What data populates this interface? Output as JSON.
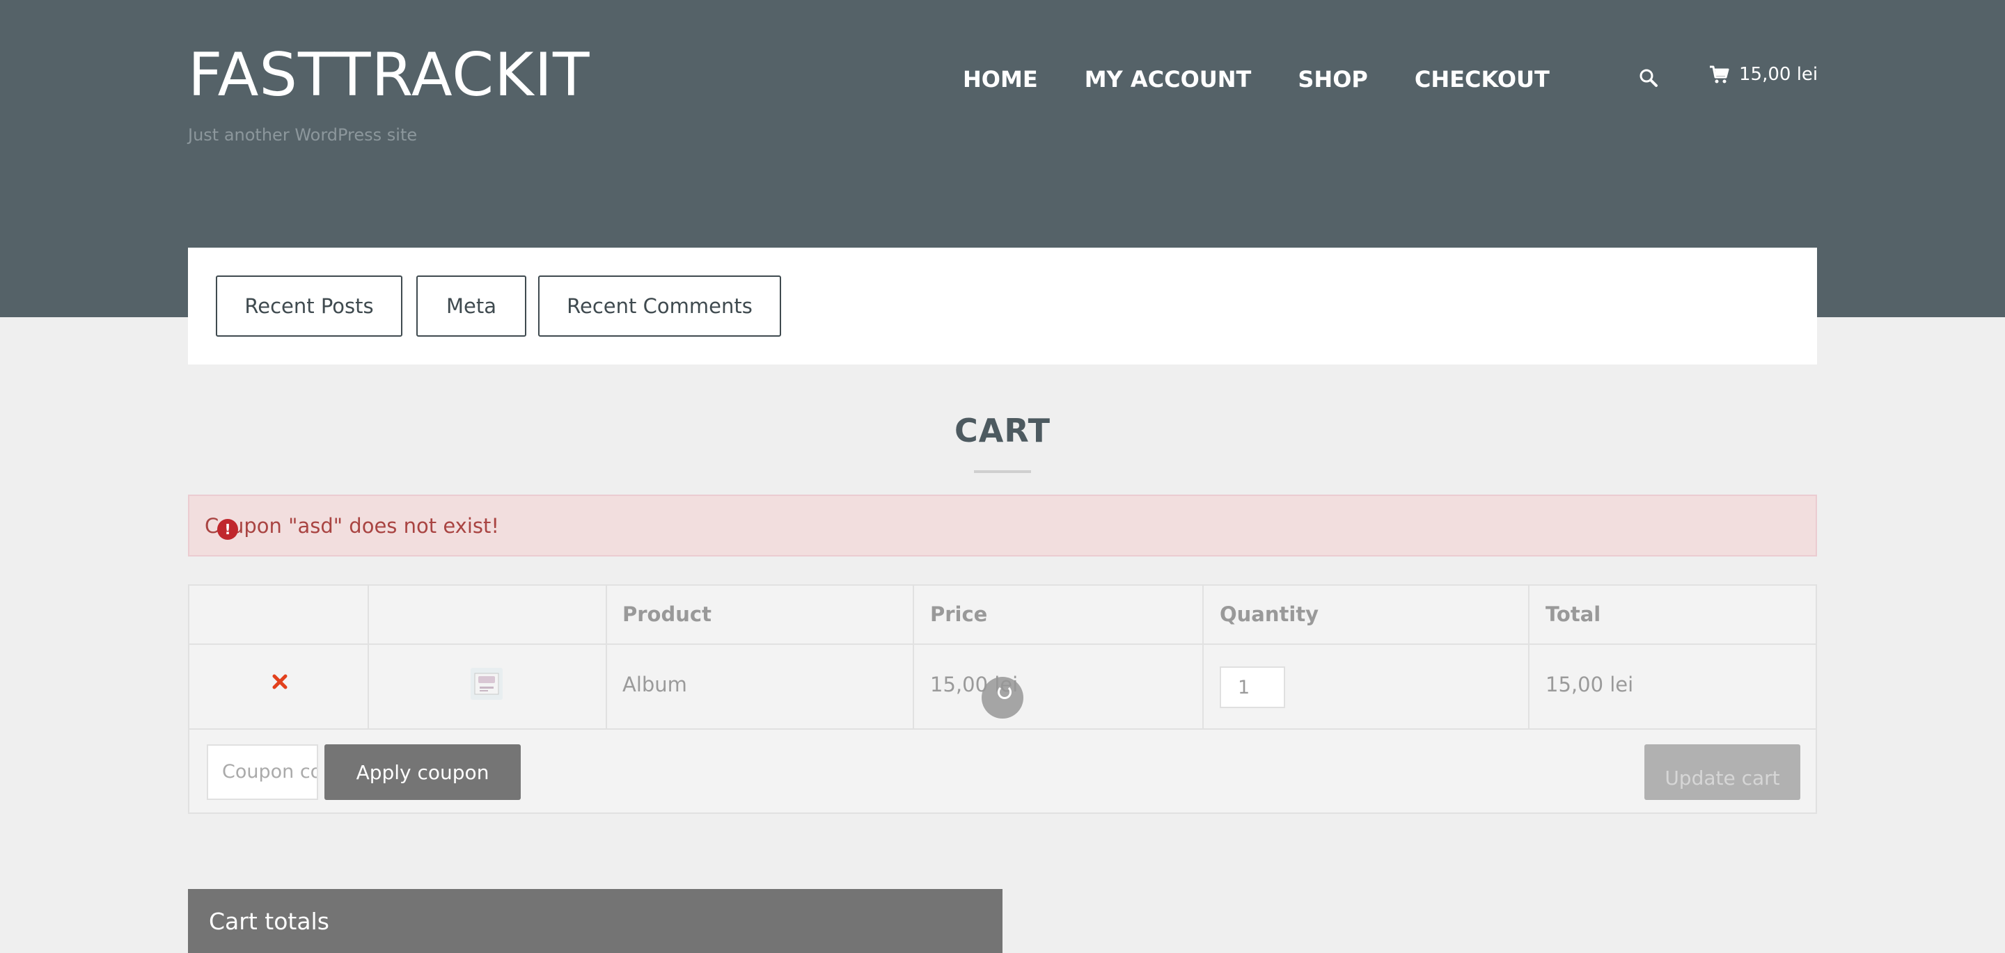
{
  "site": {
    "title": "FASTTRACKIT",
    "tagline": "Just another WordPress site"
  },
  "nav": {
    "items": [
      {
        "label": "HOME"
      },
      {
        "label": "MY ACCOUNT"
      },
      {
        "label": "SHOP"
      },
      {
        "label": "CHECKOUT"
      }
    ],
    "search_icon": "search-icon",
    "cart_total": "15,00 lei",
    "cart_icon": "cart-icon"
  },
  "widgets": {
    "tabs": [
      "Recent Posts",
      "Meta",
      "Recent Comments"
    ]
  },
  "page": {
    "title": "CART"
  },
  "notice": {
    "message": "Coupon \"asd\" does not exist!",
    "color": "#a94442"
  },
  "cart_table": {
    "headers": [
      "",
      "",
      "Product",
      "Price",
      "Quantity",
      "Total"
    ],
    "rows": [
      {
        "product": "Album",
        "price": "15,00 lei",
        "quantity": "1",
        "total": "15,00 lei"
      }
    ],
    "coupon_placeholder": "Coupon code",
    "apply_label": "Apply coupon",
    "update_label": "Update cart"
  },
  "totals": {
    "heading": "Cart totals"
  },
  "colors": {
    "header_bg": "#556268",
    "error_bg": "#f2dede",
    "remove": "#e2401c",
    "button": "#757575"
  }
}
